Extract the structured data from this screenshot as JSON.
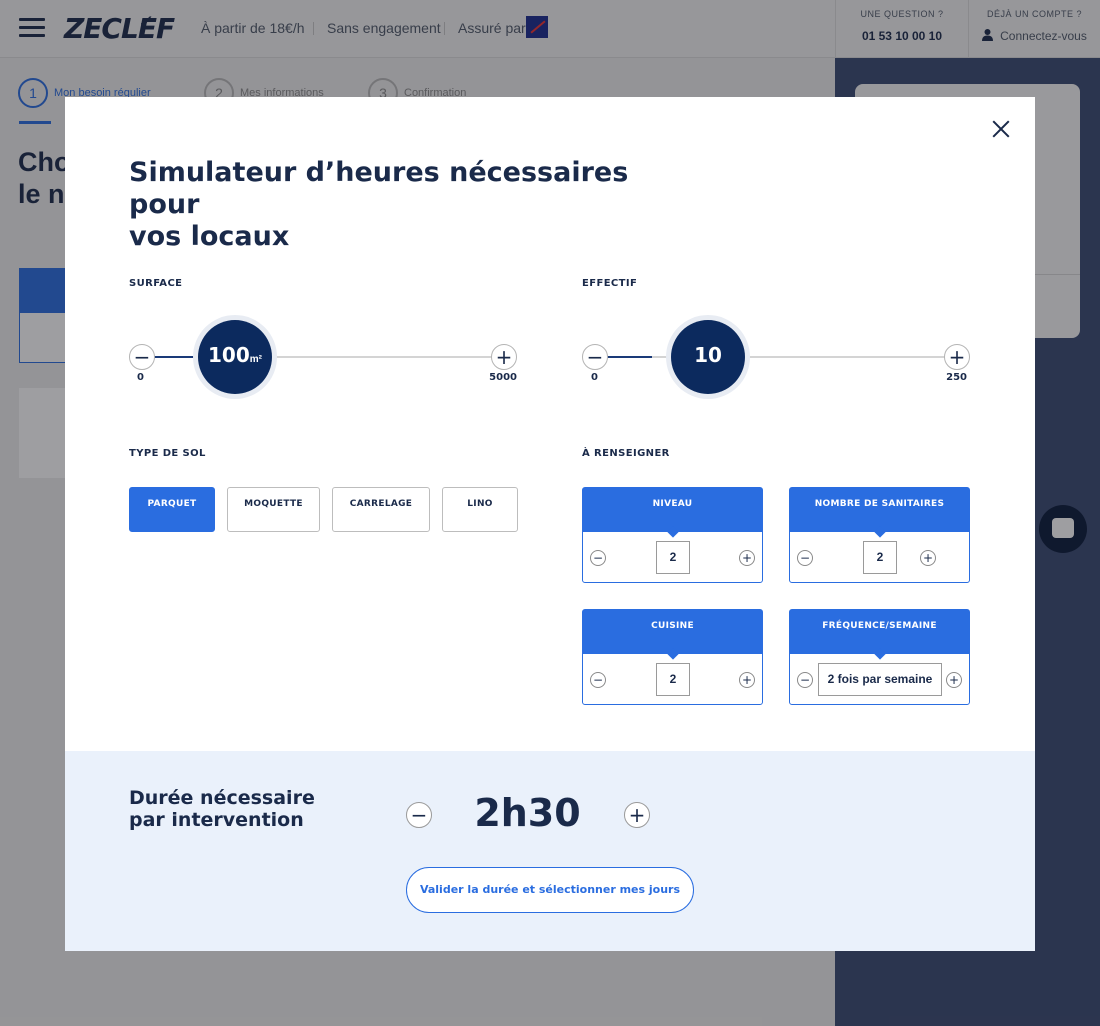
{
  "header": {
    "logo": "ZECLEF",
    "price": "À partir de 18€/h",
    "commitment": "Sans engagement",
    "insured_by": "Assuré par",
    "question_label": "UNE QUESTION ?",
    "phone": "01 53 10 00 10",
    "account_label": "DÉJÀ UN COMPTE ?",
    "login": "Connectez-vous"
  },
  "steps": [
    {
      "num": "1",
      "label": "Mon besoin régulier"
    },
    {
      "num": "2",
      "label": "Mes informations"
    },
    {
      "num": "3",
      "label": "Confirmation"
    }
  ],
  "background": {
    "title_line1": "Cho",
    "title_line2": "le n"
  },
  "modal": {
    "title_line1": "Simulateur d’heures nécessaires pour",
    "title_line2": "vos locaux",
    "surface": {
      "label": "SURFACE",
      "value": "100",
      "unit": "m²",
      "min": "0",
      "max": "5000"
    },
    "effectif": {
      "label": "EFFECTIF",
      "value": "10",
      "min": "0",
      "max": "250"
    },
    "floor": {
      "label": "TYPE DE SOL",
      "options": [
        "PARQUET",
        "MOQUETTE",
        "CARRELAGE",
        "LINO"
      ],
      "selected": "PARQUET"
    },
    "to_fill": {
      "label": "À RENSEIGNER",
      "niveau": {
        "label": "NIVEAU",
        "value": "2"
      },
      "sanitaires": {
        "label": "NOMBRE DE SANITAIRES",
        "value": "2"
      },
      "cuisine": {
        "label": "CUISINE",
        "value": "2"
      },
      "frequence": {
        "label": "FRÉQUENCE/SEMAINE",
        "value": "2 fois par semaine"
      }
    },
    "footer": {
      "duration_line1": "Durée nécessaire",
      "duration_line2": "par intervention",
      "duration_value": "2h30",
      "validate": "Valider la durée et sélectionner mes jours"
    }
  },
  "colors": {
    "accent": "#2a6de0",
    "navy": "#0c2a5e",
    "footer_bg": "#eaf1fb"
  },
  "icons": {
    "menu": "hamburger-icon",
    "close": "close-icon",
    "user": "user-icon",
    "chat": "chat-icon"
  }
}
